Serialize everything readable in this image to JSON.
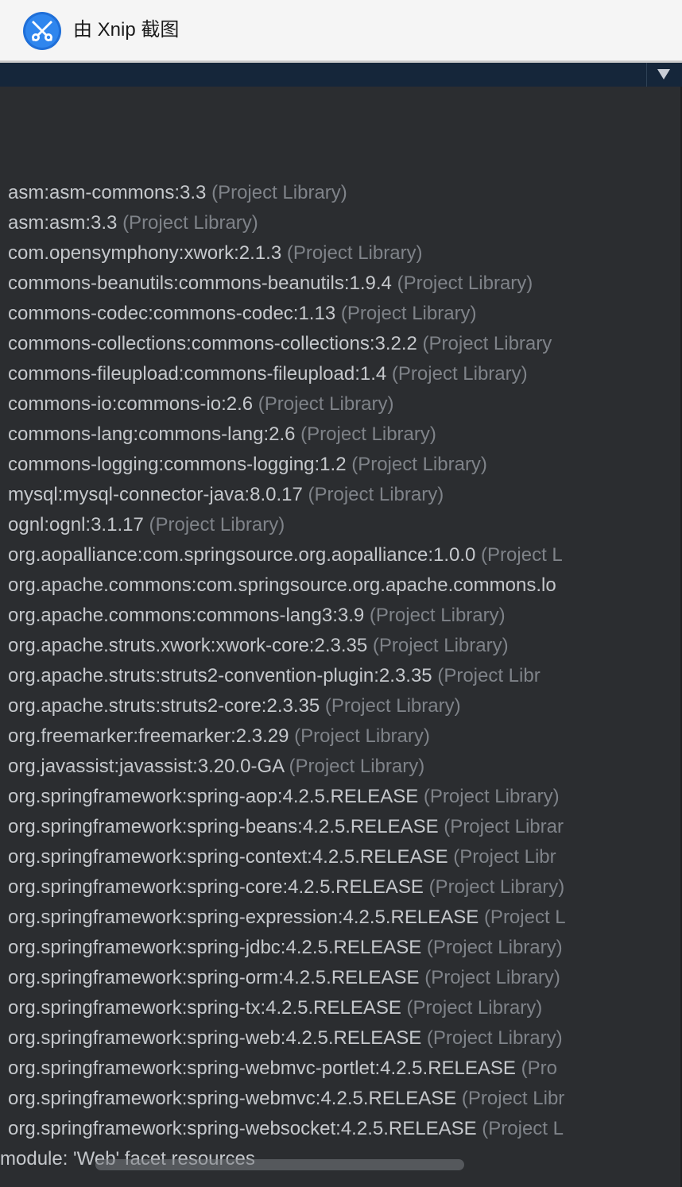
{
  "window": {
    "title": "由 Xnip 截图",
    "app_icon": "xnip-app-icon"
  },
  "toolbar": {
    "dropdown_icon": "triangle-down-icon"
  },
  "colors": {
    "background": "#2b2d30",
    "library_name": "#c5c8cc",
    "library_suffix": "#7f8389",
    "toolbar": "#15263a",
    "titlebar": "#f5f5f5"
  },
  "libraries": [
    {
      "name": "asm:asm-commons:3.3",
      "suffix": "(Project Library)"
    },
    {
      "name": "asm:asm:3.3",
      "suffix": "(Project Library)"
    },
    {
      "name": "com.opensymphony:xwork:2.1.3",
      "suffix": "(Project Library)"
    },
    {
      "name": "commons-beanutils:commons-beanutils:1.9.4",
      "suffix": "(Project Library)"
    },
    {
      "name": "commons-codec:commons-codec:1.13",
      "suffix": "(Project Library)"
    },
    {
      "name": "commons-collections:commons-collections:3.2.2",
      "suffix": "(Project Library"
    },
    {
      "name": "commons-fileupload:commons-fileupload:1.4",
      "suffix": "(Project Library)"
    },
    {
      "name": "commons-io:commons-io:2.6",
      "suffix": "(Project Library)"
    },
    {
      "name": "commons-lang:commons-lang:2.6",
      "suffix": "(Project Library)"
    },
    {
      "name": "commons-logging:commons-logging:1.2",
      "suffix": "(Project Library)"
    },
    {
      "name": "mysql:mysql-connector-java:8.0.17",
      "suffix": "(Project Library)"
    },
    {
      "name": "ognl:ognl:3.1.17",
      "suffix": "(Project Library)"
    },
    {
      "name": "org.aopalliance:com.springsource.org.aopalliance:1.0.0",
      "suffix": "(Project L"
    },
    {
      "name": "org.apache.commons:com.springsource.org.apache.commons.lo",
      "suffix": ""
    },
    {
      "name": "org.apache.commons:commons-lang3:3.9",
      "suffix": "(Project Library)"
    },
    {
      "name": "org.apache.struts.xwork:xwork-core:2.3.35",
      "suffix": "(Project Library)"
    },
    {
      "name": "org.apache.struts:struts2-convention-plugin:2.3.35",
      "suffix": "(Project Libr"
    },
    {
      "name": "org.apache.struts:struts2-core:2.3.35",
      "suffix": "(Project Library)"
    },
    {
      "name": "org.freemarker:freemarker:2.3.29",
      "suffix": "(Project Library)"
    },
    {
      "name": "org.javassist:javassist:3.20.0-GA",
      "suffix": "(Project Library)"
    },
    {
      "name": "org.springframework:spring-aop:4.2.5.RELEASE",
      "suffix": "(Project Library)"
    },
    {
      "name": "org.springframework:spring-beans:4.2.5.RELEASE",
      "suffix": "(Project Librar"
    },
    {
      "name": "org.springframework:spring-context:4.2.5.RELEASE",
      "suffix": "(Project Libr"
    },
    {
      "name": "org.springframework:spring-core:4.2.5.RELEASE",
      "suffix": "(Project Library)"
    },
    {
      "name": "org.springframework:spring-expression:4.2.5.RELEASE",
      "suffix": "(Project L"
    },
    {
      "name": "org.springframework:spring-jdbc:4.2.5.RELEASE",
      "suffix": "(Project Library)"
    },
    {
      "name": "org.springframework:spring-orm:4.2.5.RELEASE",
      "suffix": "(Project Library)"
    },
    {
      "name": "org.springframework:spring-tx:4.2.5.RELEASE",
      "suffix": "(Project Library)"
    },
    {
      "name": "org.springframework:spring-web:4.2.5.RELEASE",
      "suffix": "(Project Library)"
    },
    {
      "name": "org.springframework:spring-webmvc-portlet:4.2.5.RELEASE",
      "suffix": "(Pro"
    },
    {
      "name": "org.springframework:spring-webmvc:4.2.5.RELEASE",
      "suffix": "(Project Libr"
    },
    {
      "name": "org.springframework:spring-websocket:4.2.5.RELEASE",
      "suffix": "(Project L"
    }
  ],
  "module_row": {
    "label": "module: 'Web' facet resources"
  }
}
